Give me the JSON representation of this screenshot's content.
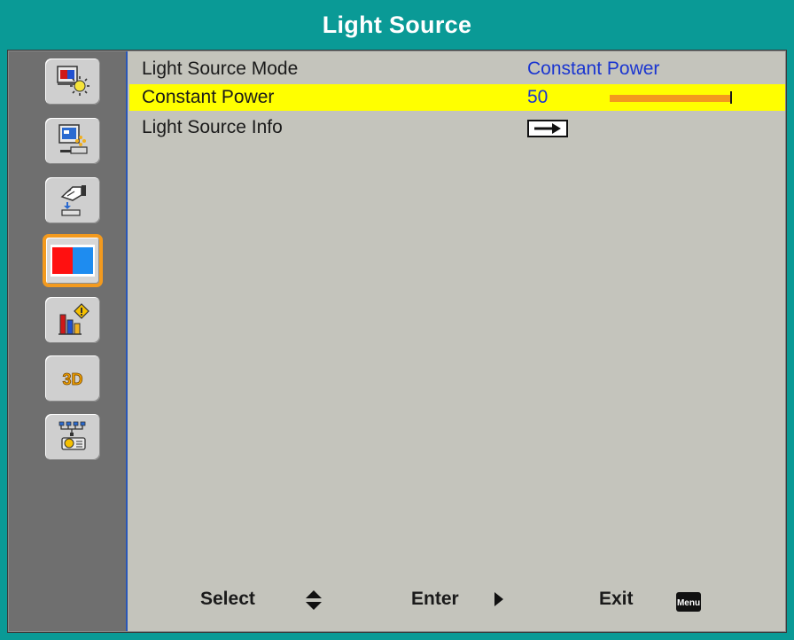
{
  "header": {
    "title": "Light Source"
  },
  "sidebar": {
    "items": [
      {
        "icon": "display-image-icon",
        "active": false
      },
      {
        "icon": "projector-display-icon",
        "active": false
      },
      {
        "icon": "hand-setup-icon",
        "active": false
      },
      {
        "icon": "light-source-icon",
        "active": true
      },
      {
        "icon": "info-chart-icon",
        "active": false
      },
      {
        "icon": "3d-icon",
        "label": "3D",
        "active": false
      },
      {
        "icon": "network-projector-icon",
        "active": false
      }
    ]
  },
  "menu": {
    "rows": [
      {
        "label": "Light Source Mode",
        "value": "Constant Power",
        "highlighted": false
      },
      {
        "label": "Constant Power",
        "value": "50",
        "slider_fraction": 0.5,
        "highlighted": true
      },
      {
        "label": "Light Source Info",
        "value_icon": "enter-arrow-icon",
        "highlighted": false
      }
    ]
  },
  "footer": {
    "select_label": "Select",
    "enter_label": "Enter",
    "exit_label": "Exit",
    "menu_key_label": "Menu"
  },
  "colors": {
    "title_bar": "#0a9a96",
    "highlight": "#ffff00",
    "value_text": "#1a35d0",
    "accent": "#f39a1e",
    "content_bg": "#c4c4bc",
    "sidebar_bg": "#6f6f6f"
  }
}
